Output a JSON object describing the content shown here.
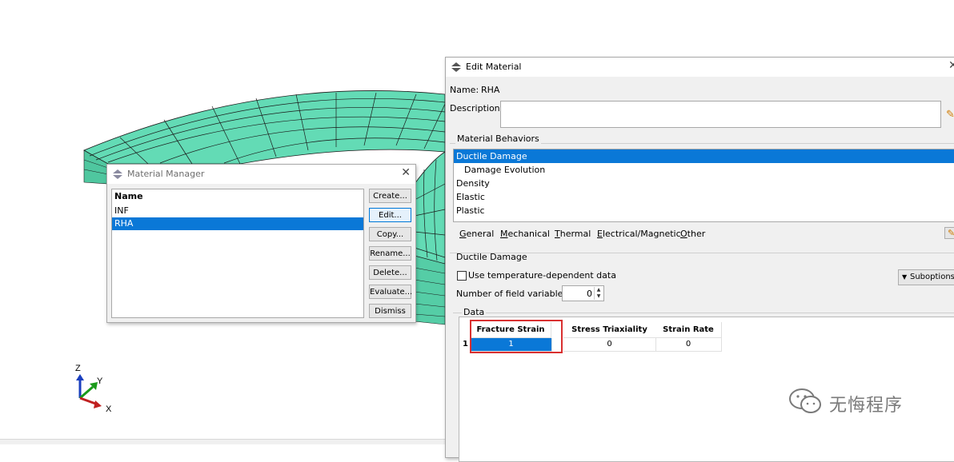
{
  "material_manager": {
    "title": "Material Manager",
    "list_header": "Name",
    "items": [
      {
        "label": "INF",
        "selected": false
      },
      {
        "label": "RHA",
        "selected": true
      }
    ],
    "buttons": {
      "create": "Create...",
      "edit": "Edit...",
      "copy": "Copy...",
      "rename": "Rename...",
      "delete": "Delete...",
      "evaluate": "Evaluate...",
      "dismiss": "Dismiss"
    },
    "close_icon": "close-icon"
  },
  "edit_material": {
    "title": "Edit Material",
    "name_label": "Name:",
    "name_value": "RHA",
    "description_label": "Description:",
    "description_value": "",
    "behaviors_label": "Material Behaviors",
    "behaviors": [
      {
        "label": "Ductile Damage",
        "selected": true
      },
      {
        "label": "Damage Evolution",
        "selected": false
      },
      {
        "label": "Density",
        "selected": false
      },
      {
        "label": "Elastic",
        "selected": false
      },
      {
        "label": "Plastic",
        "selected": false
      }
    ],
    "menu": [
      {
        "underlined": "G",
        "rest": "eneral"
      },
      {
        "underlined": "M",
        "rest": "echanical"
      },
      {
        "underlined": "T",
        "rest": "hermal"
      },
      {
        "underlined": "E",
        "rest": "lectrical/Magnetic"
      },
      {
        "underlined": "O",
        "rest": "ther"
      }
    ],
    "section_title": "Ductile Damage",
    "temp_dependent_label": "Use temperature-dependent data",
    "temp_dependent_checked": false,
    "field_vars_label": "Number of field variables:",
    "field_vars_value": "0",
    "suboptions_label": "Suboptions",
    "data_label": "Data",
    "table": {
      "columns": [
        "Fracture Strain",
        "Stress Triaxiality",
        "Strain Rate"
      ],
      "rows": [
        {
          "index": "1",
          "cells": [
            "1",
            "0",
            "0"
          ]
        }
      ]
    }
  },
  "triad": {
    "x": "X",
    "y": "Y",
    "z": "Z"
  },
  "watermark": {
    "text": "无悔程序"
  },
  "colors": {
    "mesh_fill": "#63dbb5",
    "mesh_line": "#1a1a1a",
    "selection": "#0a78d7",
    "highlight_box": "#d93030"
  }
}
